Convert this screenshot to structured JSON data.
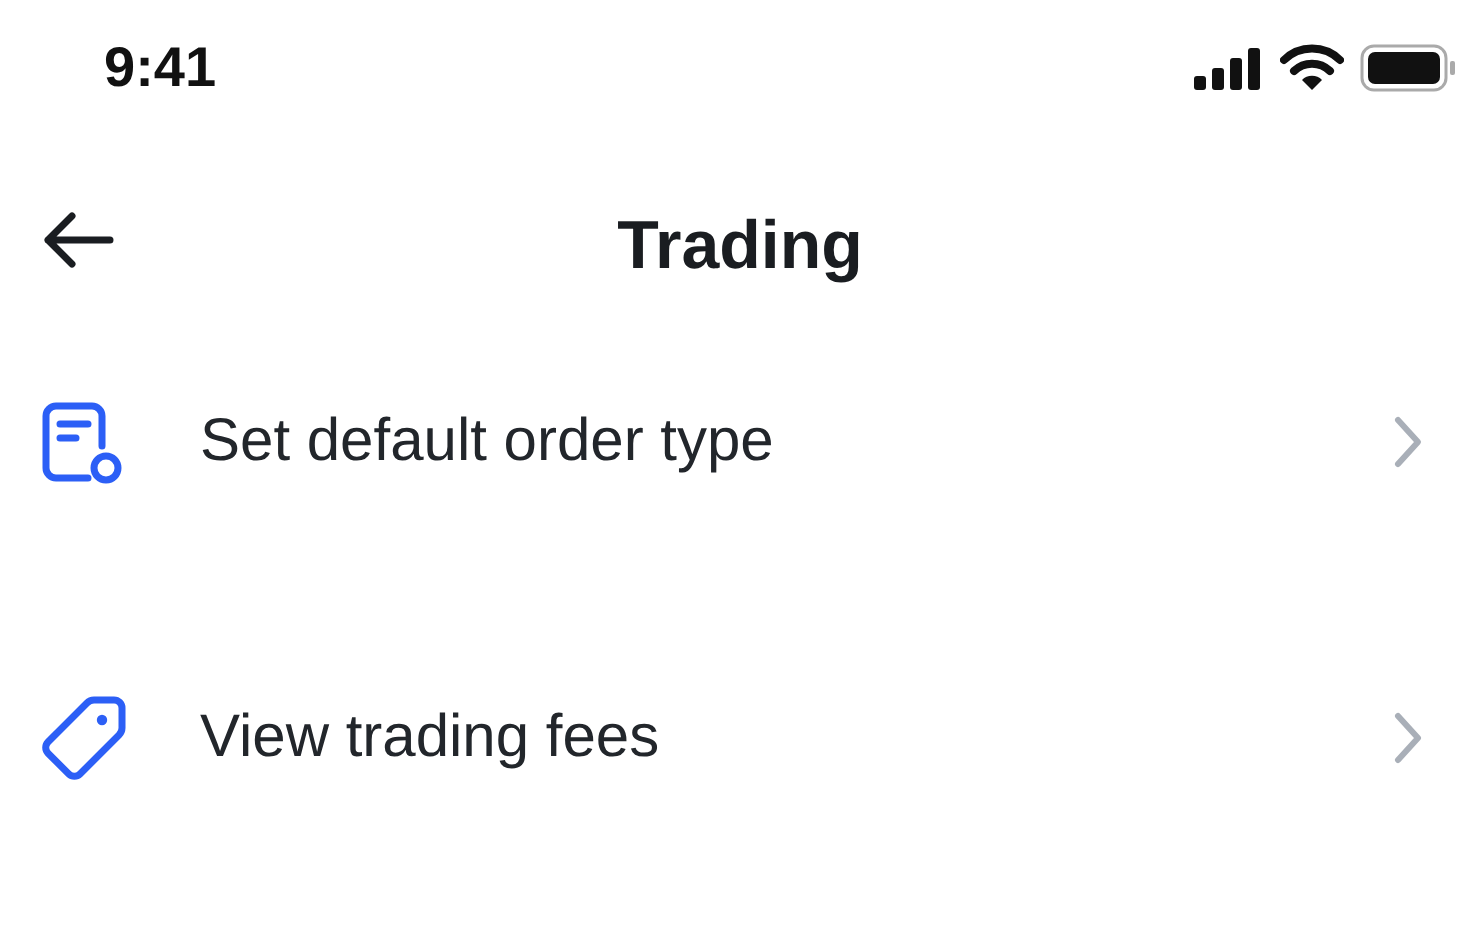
{
  "status_bar": {
    "time": "9:41"
  },
  "header": {
    "title": "Trading"
  },
  "items": [
    {
      "kind": "order",
      "label": "Set default order type"
    },
    {
      "kind": "tag",
      "label": "View trading fees"
    }
  ]
}
